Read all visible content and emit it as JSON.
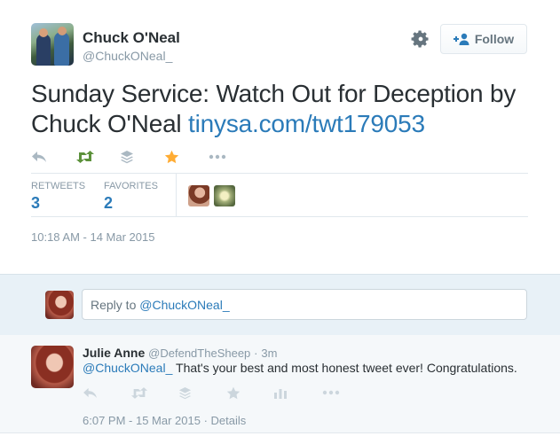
{
  "tweet": {
    "author": {
      "fullname": "Chuck O'Neal",
      "username": "@ChuckONeal_"
    },
    "text": "Sunday Service: Watch Out for Deception by Chuck O'Neal ",
    "link": "tinysa.com/twt179053",
    "follow_label": "Follow",
    "stats": {
      "retweets_label": "RETWEETS",
      "retweets": "3",
      "favorites_label": "FAVORITES",
      "favorites": "2"
    },
    "timestamp": "10:18 AM - 14 Mar 2015"
  },
  "reply_box": {
    "prefix": "Reply to ",
    "mention": "@ChuckONeal_"
  },
  "reply": {
    "fullname": "Julie Anne",
    "username": "@DefendTheSheep",
    "separator": "·",
    "time": "3m",
    "mention": "@ChuckONeal_",
    "text": " That's your best and most honest tweet ever!  Congratulations.",
    "footer": "6:07 PM - 15 Mar 2015 · Details"
  },
  "colors": {
    "link": "#2b7bb9",
    "retweet_active": "#5c913b",
    "favorite_active": "#ffac33",
    "muted": "#8899a6"
  },
  "icons": [
    "gear-icon",
    "follow-user-icon",
    "reply-icon",
    "retweet-icon",
    "buffer-icon",
    "favorite-star-icon",
    "more-icon",
    "stats-icon"
  ]
}
